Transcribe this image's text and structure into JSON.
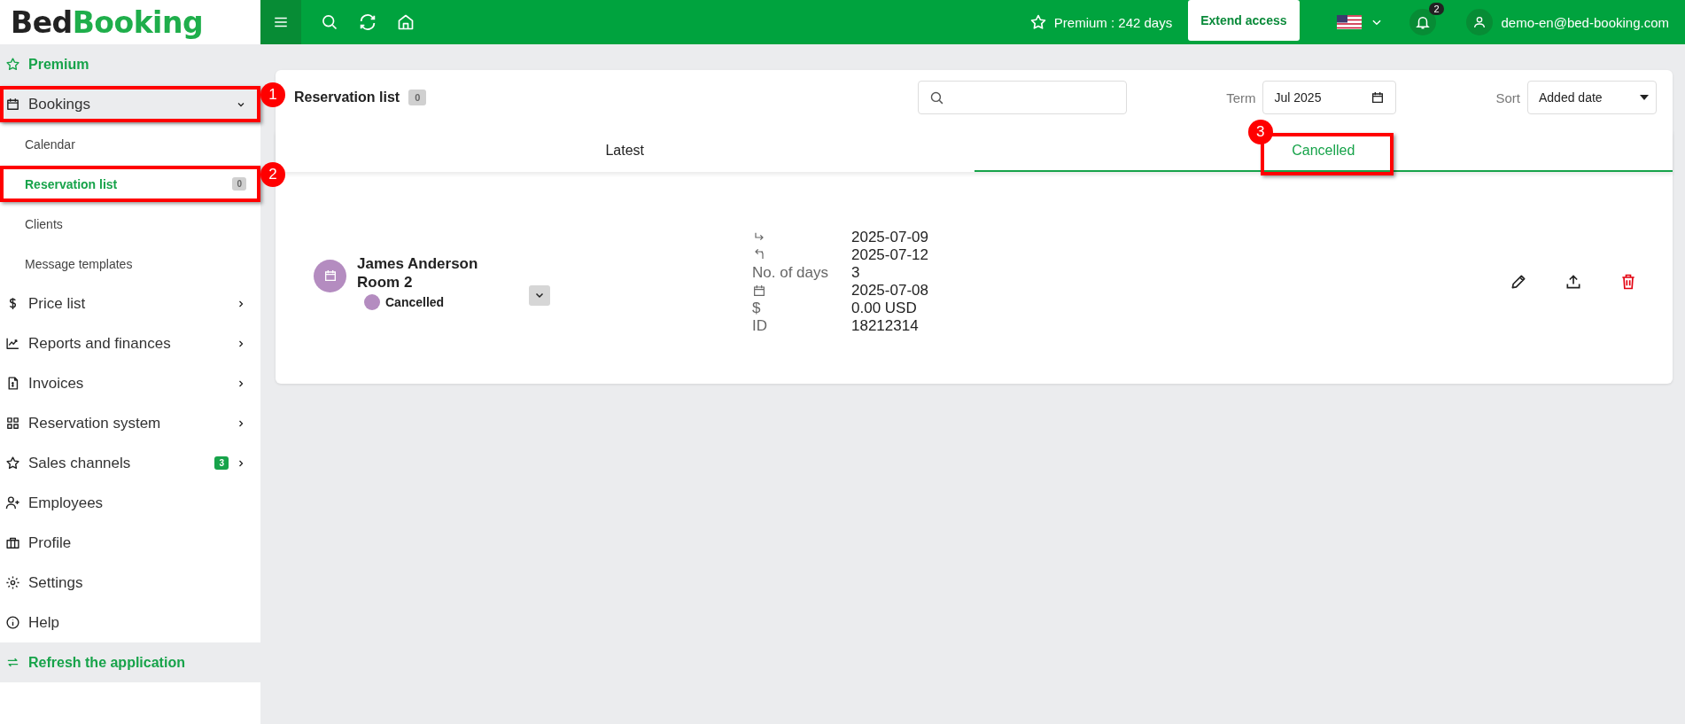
{
  "logo": {
    "part_1": "Bed",
    "part_2": "Booking"
  },
  "topbar": {
    "premium": "Premium : 242 days",
    "extend_button": "Extend access",
    "notifications": "2",
    "user": "demo-en@bed-booking.com"
  },
  "sidebar": {
    "items": [
      {
        "kind": "section",
        "label": "Premium"
      },
      {
        "kind": "group",
        "label": "Bookings",
        "expanded": true,
        "marker": "1"
      },
      {
        "kind": "sub",
        "label": "Calendar",
        "selected": false
      },
      {
        "kind": "sub",
        "label": "Reservation list",
        "selected": true,
        "count": "0",
        "marker": "2"
      },
      {
        "kind": "sub",
        "label": "Clients",
        "selected": false
      },
      {
        "kind": "sub",
        "label": "Message templates",
        "selected": false
      },
      {
        "kind": "group",
        "label": "Price list",
        "expanded": false
      },
      {
        "kind": "group",
        "label": "Reports and finances",
        "expanded": false
      },
      {
        "kind": "group",
        "label": "Invoices",
        "expanded": false
      },
      {
        "kind": "group",
        "label": "Reservation system",
        "expanded": false
      },
      {
        "kind": "group",
        "label": "Sales channels",
        "expanded": false,
        "count": "3"
      },
      {
        "kind": "link",
        "label": "Employees"
      },
      {
        "kind": "link",
        "label": "Profile"
      },
      {
        "kind": "link",
        "label": "Settings"
      },
      {
        "kind": "link",
        "label": "Help"
      },
      {
        "kind": "action",
        "label": "Refresh the application"
      }
    ]
  },
  "content": {
    "title": "Reservation list",
    "count": "0",
    "term_label": "Term",
    "term_value": "Jul 2025",
    "sort_label": "Sort",
    "sort_value": "Added date",
    "tabs": [
      {
        "label": "Latest",
        "selected": false
      },
      {
        "label": "Cancelled",
        "selected": true,
        "marker": "3"
      }
    ],
    "bookings": [
      {
        "guest": "James Anderson",
        "room": "Room 2",
        "status": "Cancelled",
        "color": "#b48cc0",
        "details": [
          {
            "kind": "arrival",
            "value": "2025-07-09"
          },
          {
            "kind": "departure",
            "value": "2025-07-12"
          },
          {
            "kind": "text",
            "label": "No. of days",
            "value": "3"
          },
          {
            "kind": "created",
            "value": "2025-07-08"
          },
          {
            "kind": "text",
            "label": "$",
            "value": "0.00 USD"
          },
          {
            "kind": "text",
            "label": "ID",
            "value": "18212314"
          }
        ]
      }
    ]
  }
}
